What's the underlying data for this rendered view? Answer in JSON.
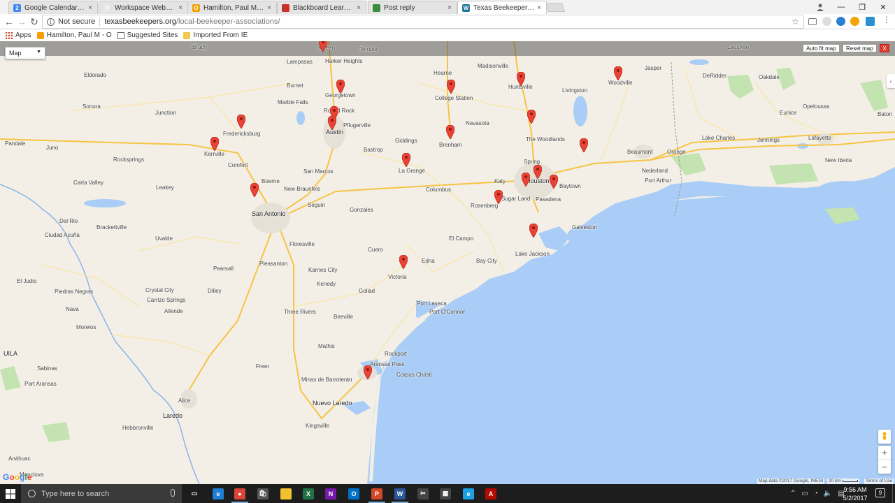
{
  "browser": {
    "tabs": [
      {
        "title": "Google Calendar - Week",
        "icon": "calendar-icon",
        "color": "#4285f4",
        "glyph": "2"
      },
      {
        "title": "Workspace Webmail :: M",
        "icon": "webmail-icon",
        "color": "#e6e6e6",
        "glyph": "H"
      },
      {
        "title": "Hamilton, Paul M - Outlo",
        "icon": "owa-icon",
        "color": "#f5a000",
        "glyph": "O"
      },
      {
        "title": "Blackboard Learn 9 Login",
        "icon": "blackboard-icon",
        "color": "#c8312b",
        "glyph": "shsu"
      },
      {
        "title": "Post reply",
        "icon": "globe-icon",
        "color": "#3a8e3a",
        "glyph": ""
      },
      {
        "title": "Texas Beekeepers Associ",
        "icon": "wordpress-icon",
        "color": "#21759b",
        "glyph": "W"
      }
    ],
    "close_glyph": "×",
    "window_controls": {
      "minimize": "—",
      "maximize": "❐",
      "close": "✕"
    },
    "address": {
      "security": "Not secure",
      "host": "texasbeekeepers.org",
      "path": "/local-beekeeper-associations/"
    },
    "bookmarks": [
      {
        "label": "Apps",
        "icon": "apps-grid-icon"
      },
      {
        "label": "Hamilton, Paul M - O",
        "icon": "owa-icon"
      },
      {
        "label": "Suggested Sites",
        "icon": "page-icon"
      },
      {
        "label": "Imported From IE",
        "icon": "folder-icon"
      }
    ]
  },
  "map": {
    "map_type": "Map",
    "buttons": {
      "auto_fit": "Auto fit map",
      "reset": "Reset map",
      "close": "X"
    },
    "google_logo": "Google",
    "attribution": "Map data ©2017 Google, INEGI",
    "scale": "20 km",
    "terms": "Terms of Use",
    "zoom_in": "+",
    "zoom_out": "−",
    "cities": [
      {
        "name": "Killeen",
        "big": false
      },
      {
        "name": "Temple",
        "big": false
      },
      {
        "name": "Brady",
        "big": false
      },
      {
        "name": "Lampasas",
        "big": false
      },
      {
        "name": "Harker Heights",
        "big": false
      },
      {
        "name": "Hearne",
        "big": false
      },
      {
        "name": "Madisonville",
        "big": false
      },
      {
        "name": "Leesville",
        "big": false
      },
      {
        "name": "Jasper",
        "big": false
      },
      {
        "name": "Burnet",
        "big": false
      },
      {
        "name": "Georgetown",
        "big": false
      },
      {
        "name": "College Station",
        "big": false
      },
      {
        "name": "Huntsville",
        "big": false
      },
      {
        "name": "Livingston",
        "big": false
      },
      {
        "name": "Woodville",
        "big": false
      },
      {
        "name": "DeRidder",
        "big": false
      },
      {
        "name": "Oakdale",
        "big": false
      },
      {
        "name": "Eldorado",
        "big": false
      },
      {
        "name": "Sonora",
        "big": false
      },
      {
        "name": "Marble Falls",
        "big": false
      },
      {
        "name": "Round Rock",
        "big": false
      },
      {
        "name": "Pflugerville",
        "big": false
      },
      {
        "name": "Austin",
        "big": true
      },
      {
        "name": "Navasota",
        "big": false
      },
      {
        "name": "Junction",
        "big": false
      },
      {
        "name": "Fredericksburg",
        "big": false
      },
      {
        "name": "Bastrop",
        "big": false
      },
      {
        "name": "Giddings",
        "big": false
      },
      {
        "name": "Brenham",
        "big": false
      },
      {
        "name": "The Woodlands",
        "big": false
      },
      {
        "name": "Opelousas",
        "big": false
      },
      {
        "name": "Eunice",
        "big": false
      },
      {
        "name": "Baton",
        "big": false
      },
      {
        "name": "Kerrville",
        "big": false
      },
      {
        "name": "Comfort",
        "big": false
      },
      {
        "name": "Lake Charles",
        "big": false
      },
      {
        "name": "Jennings",
        "big": false
      },
      {
        "name": "Lafayette",
        "big": false
      },
      {
        "name": "Beaumont",
        "big": false
      },
      {
        "name": "Orange",
        "big": false
      },
      {
        "name": "Pandale",
        "big": false
      },
      {
        "name": "Juno",
        "big": false
      },
      {
        "name": "Rocksprings",
        "big": false
      },
      {
        "name": "San Marcos",
        "big": false
      },
      {
        "name": "La Grange",
        "big": false
      },
      {
        "name": "Spring",
        "big": false
      },
      {
        "name": "New Iberia",
        "big": false
      },
      {
        "name": "Boerne",
        "big": false
      },
      {
        "name": "Katy",
        "big": false
      },
      {
        "name": "Houston",
        "big": true
      },
      {
        "name": "Nederland",
        "big": false
      },
      {
        "name": "Port Arthur",
        "big": false
      },
      {
        "name": "Carta Valley",
        "big": false
      },
      {
        "name": "Leakey",
        "big": false
      },
      {
        "name": "New Braunfels",
        "big": false
      },
      {
        "name": "Columbus",
        "big": false
      },
      {
        "name": "Sugar Land",
        "big": false
      },
      {
        "name": "Baytown",
        "big": false
      },
      {
        "name": "Pasadena",
        "big": false
      },
      {
        "name": "Seguin",
        "big": false
      },
      {
        "name": "Gonzales",
        "big": false
      },
      {
        "name": "San Antonio",
        "big": true
      },
      {
        "name": "Rosenberg",
        "big": false
      },
      {
        "name": "Del Rio",
        "big": false
      },
      {
        "name": "Brackettville",
        "big": false
      },
      {
        "name": "Ciudad Acuña",
        "big": false
      },
      {
        "name": "Uvalde",
        "big": false
      },
      {
        "name": "Galveston",
        "big": false
      },
      {
        "name": "El Campo",
        "big": false
      },
      {
        "name": "Lake Jackson",
        "big": false
      },
      {
        "name": "Floresville",
        "big": false
      },
      {
        "name": "Cuero",
        "big": false
      },
      {
        "name": "Pleasanton",
        "big": false
      },
      {
        "name": "Bay City",
        "big": false
      },
      {
        "name": "Edna",
        "big": false
      },
      {
        "name": "Pearsall",
        "big": false
      },
      {
        "name": "Karnes City",
        "big": false
      },
      {
        "name": "El Judio",
        "big": false
      },
      {
        "name": "Kenedy",
        "big": false
      },
      {
        "name": "Victoria",
        "big": false
      },
      {
        "name": "Piedras Negras",
        "big": false
      },
      {
        "name": "Dilley",
        "big": false
      },
      {
        "name": "Goliad",
        "big": false
      },
      {
        "name": "Crystal City",
        "big": false
      },
      {
        "name": "Carrizo Springs",
        "big": false
      },
      {
        "name": "Port Lavaca",
        "big": false
      },
      {
        "name": "Port O'Connor",
        "big": false
      },
      {
        "name": "Nava",
        "big": false
      },
      {
        "name": "Allende",
        "big": false
      },
      {
        "name": "Three Rivers",
        "big": false
      },
      {
        "name": "Beeville",
        "big": false
      },
      {
        "name": "Morelos",
        "big": false
      },
      {
        "name": "Mathis",
        "big": false
      },
      {
        "name": "UILA",
        "big": true
      },
      {
        "name": "Rockport",
        "big": false
      },
      {
        "name": "Sabinas",
        "big": false
      },
      {
        "name": "Freer",
        "big": false
      },
      {
        "name": "Aransas Pass",
        "big": false
      },
      {
        "name": "Corpus Christi",
        "big": false
      },
      {
        "name": "Port Aransas",
        "big": false
      },
      {
        "name": "Minas de Barroterán",
        "big": false
      },
      {
        "name": "Alice",
        "big": false
      },
      {
        "name": "Laredo",
        "big": true
      },
      {
        "name": "Nuevo Laredo",
        "big": true
      },
      {
        "name": "Kingsville",
        "big": false
      },
      {
        "name": "Hebbronville",
        "big": false
      },
      {
        "name": "Anáhuac",
        "big": false
      },
      {
        "name": "Monclova",
        "big": false
      },
      {
        "name": "Frontera",
        "big": false
      }
    ],
    "marker_count": 24
  },
  "taskbar": {
    "search_placeholder": "Type here to search",
    "time": "9:56 AM",
    "date": "5/2/2017",
    "notification_count": "9",
    "apps": [
      {
        "name": "task-view",
        "color": "#1d1d1d",
        "glyph": "▭"
      },
      {
        "name": "edge",
        "color": "#1f7fd6",
        "glyph": "e"
      },
      {
        "name": "chrome",
        "color": "#db4437",
        "glyph": "●"
      },
      {
        "name": "store",
        "color": "#555",
        "glyph": "🛍"
      },
      {
        "name": "file-explorer",
        "color": "#f2c12e",
        "glyph": ""
      },
      {
        "name": "excel",
        "color": "#217346",
        "glyph": "X"
      },
      {
        "name": "onenote",
        "color": "#7719aa",
        "glyph": "N"
      },
      {
        "name": "outlook",
        "color": "#0072c6",
        "glyph": "O"
      },
      {
        "name": "powerpoint",
        "color": "#d24726",
        "glyph": "P"
      },
      {
        "name": "word",
        "color": "#2b579a",
        "glyph": "W"
      },
      {
        "name": "snipping",
        "color": "#444",
        "glyph": "✂"
      },
      {
        "name": "calculator",
        "color": "#444",
        "glyph": "▦"
      },
      {
        "name": "internet-explorer",
        "color": "#1ba1e2",
        "glyph": "e"
      },
      {
        "name": "acrobat",
        "color": "#b30b00",
        "glyph": "A"
      }
    ]
  }
}
